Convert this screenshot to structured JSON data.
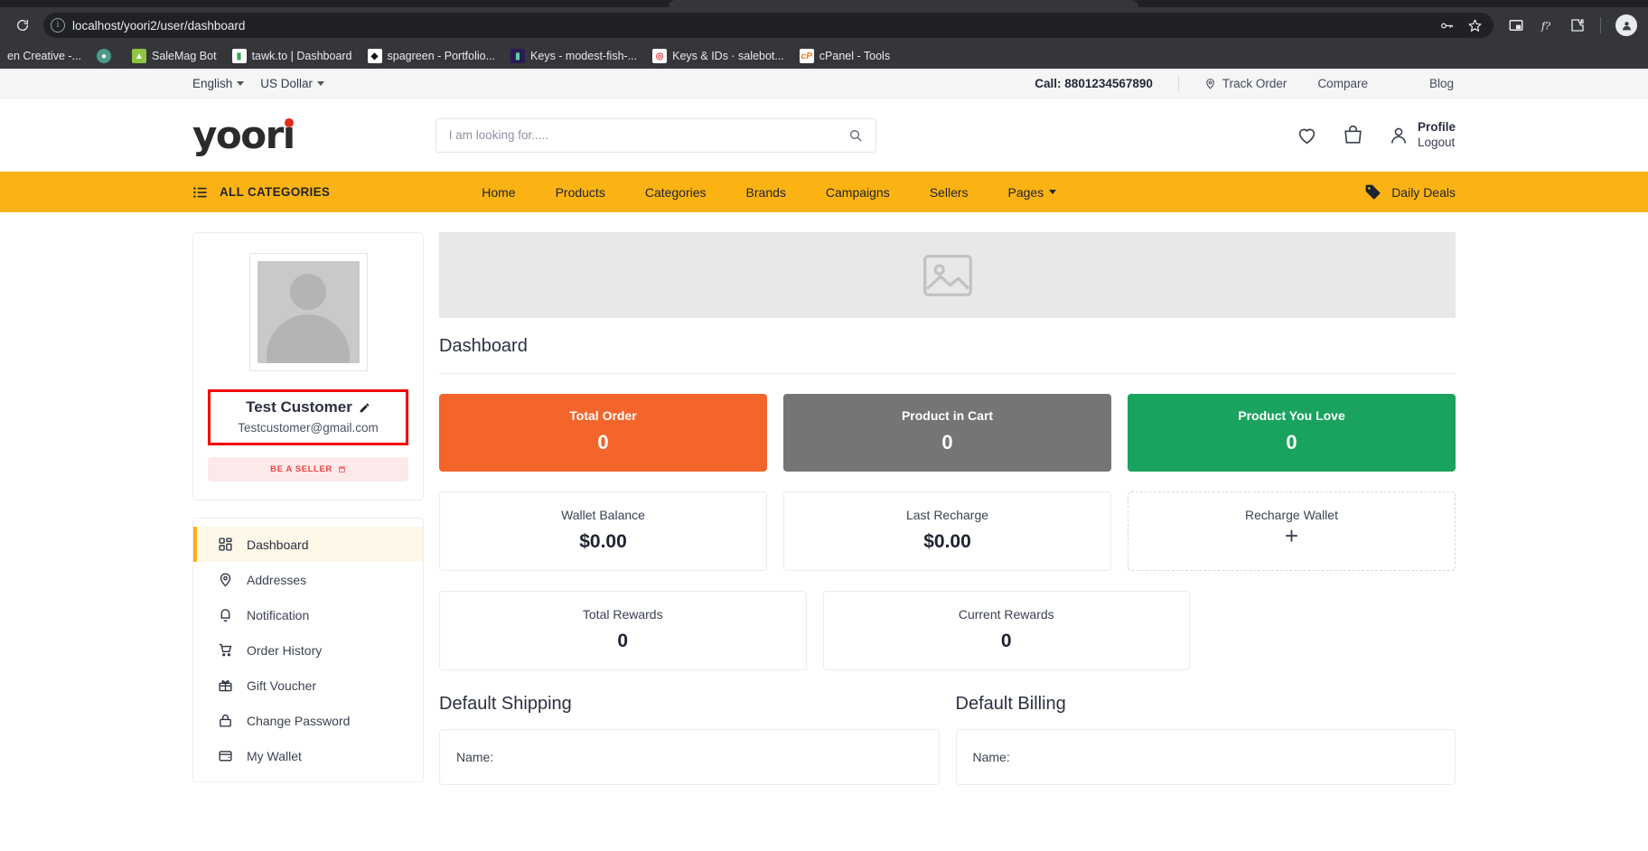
{
  "browser": {
    "url": "localhost/yoori2/user/dashboard",
    "reload_icon": "reload-icon",
    "info_icon": "site-info-icon",
    "bookmarks": [
      {
        "label": "en Creative -...",
        "color": "#35363a",
        "glyph": ""
      },
      {
        "label": "",
        "color": "#4a9b8e",
        "glyph": "●"
      },
      {
        "label": "SaleMag Bot",
        "color": "#7cb342",
        "glyph": "▲"
      },
      {
        "label": "tawk.to | Dashboard",
        "color": "#2fa84f",
        "glyph": "▮"
      },
      {
        "label": "spagreen - Portfolio...",
        "color": "#ffffff",
        "glyph": "◆"
      },
      {
        "label": "Keys - modest-fish-...",
        "color": "#2b1b55",
        "glyph": "▮"
      },
      {
        "label": "Keys & IDs · salebot...",
        "color": "#e23b3b",
        "glyph": "◎"
      },
      {
        "label": "cPanel - Tools",
        "color": "#f07528",
        "glyph": "cP"
      }
    ],
    "toolbar_icons": [
      "password-key-icon",
      "bookmark-star-icon",
      "picture-in-picture-icon",
      "formula-extension-icon",
      "extensions-puzzle-icon",
      "profile-avatar-icon"
    ]
  },
  "topbar": {
    "language": "English",
    "currency": "US Dollar",
    "call": "Call: 8801234567890",
    "track_order": "Track Order",
    "compare": "Compare",
    "blog": "Blog"
  },
  "header": {
    "logo": "yoori",
    "search_placeholder": "I am looking for.....",
    "search_value": "",
    "profile_name": "Profile",
    "logout": "Logout"
  },
  "catnav": {
    "all_categories": "ALL CATEGORIES",
    "items": [
      {
        "label": "Home",
        "has_caret": false
      },
      {
        "label": "Products",
        "has_caret": false
      },
      {
        "label": "Categories",
        "has_caret": false
      },
      {
        "label": "Brands",
        "has_caret": false
      },
      {
        "label": "Campaigns",
        "has_caret": false
      },
      {
        "label": "Sellers",
        "has_caret": false
      },
      {
        "label": "Pages",
        "has_caret": true
      }
    ],
    "daily_deals": "Daily Deals"
  },
  "sidebar": {
    "customer_name": "Test Customer",
    "customer_email": "Testcustomer@gmail.com",
    "be_a_seller": "BE A SELLER",
    "menu": [
      {
        "label": "Dashboard",
        "icon": "grid-icon",
        "active": true
      },
      {
        "label": "Addresses",
        "icon": "location-pin-icon",
        "active": false
      },
      {
        "label": "Notification",
        "icon": "bell-icon",
        "active": false
      },
      {
        "label": "Order History",
        "icon": "cart-icon",
        "active": false
      },
      {
        "label": "Gift Voucher",
        "icon": "gift-icon",
        "active": false
      },
      {
        "label": "Change Password",
        "icon": "lock-icon",
        "active": false
      },
      {
        "label": "My Wallet",
        "icon": "wallet-icon",
        "active": false
      }
    ]
  },
  "main": {
    "page_title": "Dashboard",
    "stats_primary": [
      {
        "label": "Total Order",
        "value": "0",
        "color": "#f4652b"
      },
      {
        "label": "Product in Cart",
        "value": "0",
        "color": "#757575"
      },
      {
        "label": "Product You Love",
        "value": "0",
        "color": "#1aa35e"
      }
    ],
    "stats_wallet": [
      {
        "label": "Wallet Balance",
        "value": "$0.00",
        "style": "solid"
      },
      {
        "label": "Last Recharge",
        "value": "$0.00",
        "style": "solid"
      },
      {
        "label": "Recharge Wallet",
        "value": "+",
        "style": "dashed"
      }
    ],
    "stats_rewards": [
      {
        "label": "Total Rewards",
        "value": "0",
        "style": "solid"
      },
      {
        "label": "Current Rewards",
        "value": "0",
        "style": "solid"
      }
    ],
    "default_shipping_title": "Default Shipping",
    "default_billing_title": "Default Billing",
    "shipping_name_label": "Name:",
    "billing_name_label": "Name:"
  }
}
